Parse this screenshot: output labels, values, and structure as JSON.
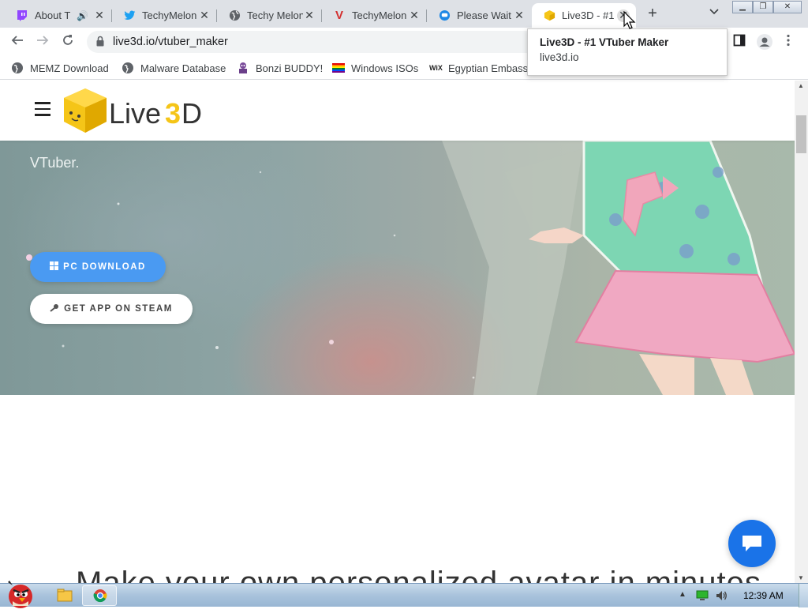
{
  "browser": {
    "tabs": [
      {
        "title": "About T",
        "icon": "twitch-icon",
        "audio": true
      },
      {
        "title": "TechyMelon",
        "icon": "twitter-bird-icon"
      },
      {
        "title": "Techy Melon",
        "icon": "globe-icon"
      },
      {
        "title": "TechyMelon",
        "icon": "vivaldi-v-icon"
      },
      {
        "title": "Please Wait",
        "icon": "chat-bubble-icon"
      },
      {
        "title": "Live3D - #1",
        "icon": "live3d-cube-icon",
        "active": true
      }
    ],
    "url": "live3d.io/vtuber_maker",
    "bookmarks": [
      {
        "label": "MEMZ Download",
        "icon": "globe-icon"
      },
      {
        "label": "Malware Database",
        "icon": "globe-icon"
      },
      {
        "label": "Bonzi BUDDY!",
        "icon": "bonzi-icon"
      },
      {
        "label": "Windows ISOs",
        "icon": "rainbow-flag-icon"
      },
      {
        "label": "Egyptian Embass",
        "icon": "wix-icon"
      }
    ],
    "tooltip": {
      "title": "Live3D - #1 VTuber Maker",
      "domain": "live3d.io"
    }
  },
  "site": {
    "logo_text": "Live3D",
    "hero_subtitle": "VTuber.",
    "pc_download_label": "PC DOWNLOAD",
    "steam_label": "GET APP ON STEAM",
    "headline_partial": "Make your own personalized avatar in minutes"
  },
  "taskbar": {
    "time": "12:39 AM"
  },
  "colors": {
    "accent_blue": "#4a9af2",
    "chat_blue": "#1a73e8",
    "logo_yellow": "#f5c518"
  }
}
